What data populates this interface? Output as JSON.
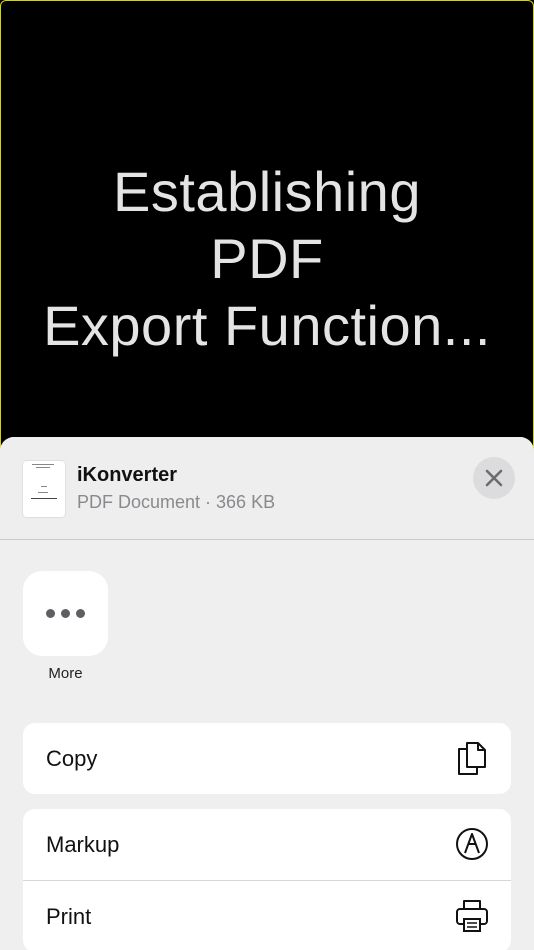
{
  "background": {
    "lines": [
      "Establishing",
      "PDF",
      "Export Function..."
    ]
  },
  "share_sheet": {
    "title": "iKonverter",
    "subtitle": "PDF Document · 366 KB",
    "close_icon": "close-icon",
    "apps": [
      {
        "label": "More",
        "icon": "ellipsis-icon"
      }
    ],
    "actions": [
      {
        "label": "Copy",
        "icon": "copy-icon"
      },
      {
        "label": "Markup",
        "icon": "markup-icon"
      },
      {
        "label": "Print",
        "icon": "print-icon"
      }
    ]
  }
}
